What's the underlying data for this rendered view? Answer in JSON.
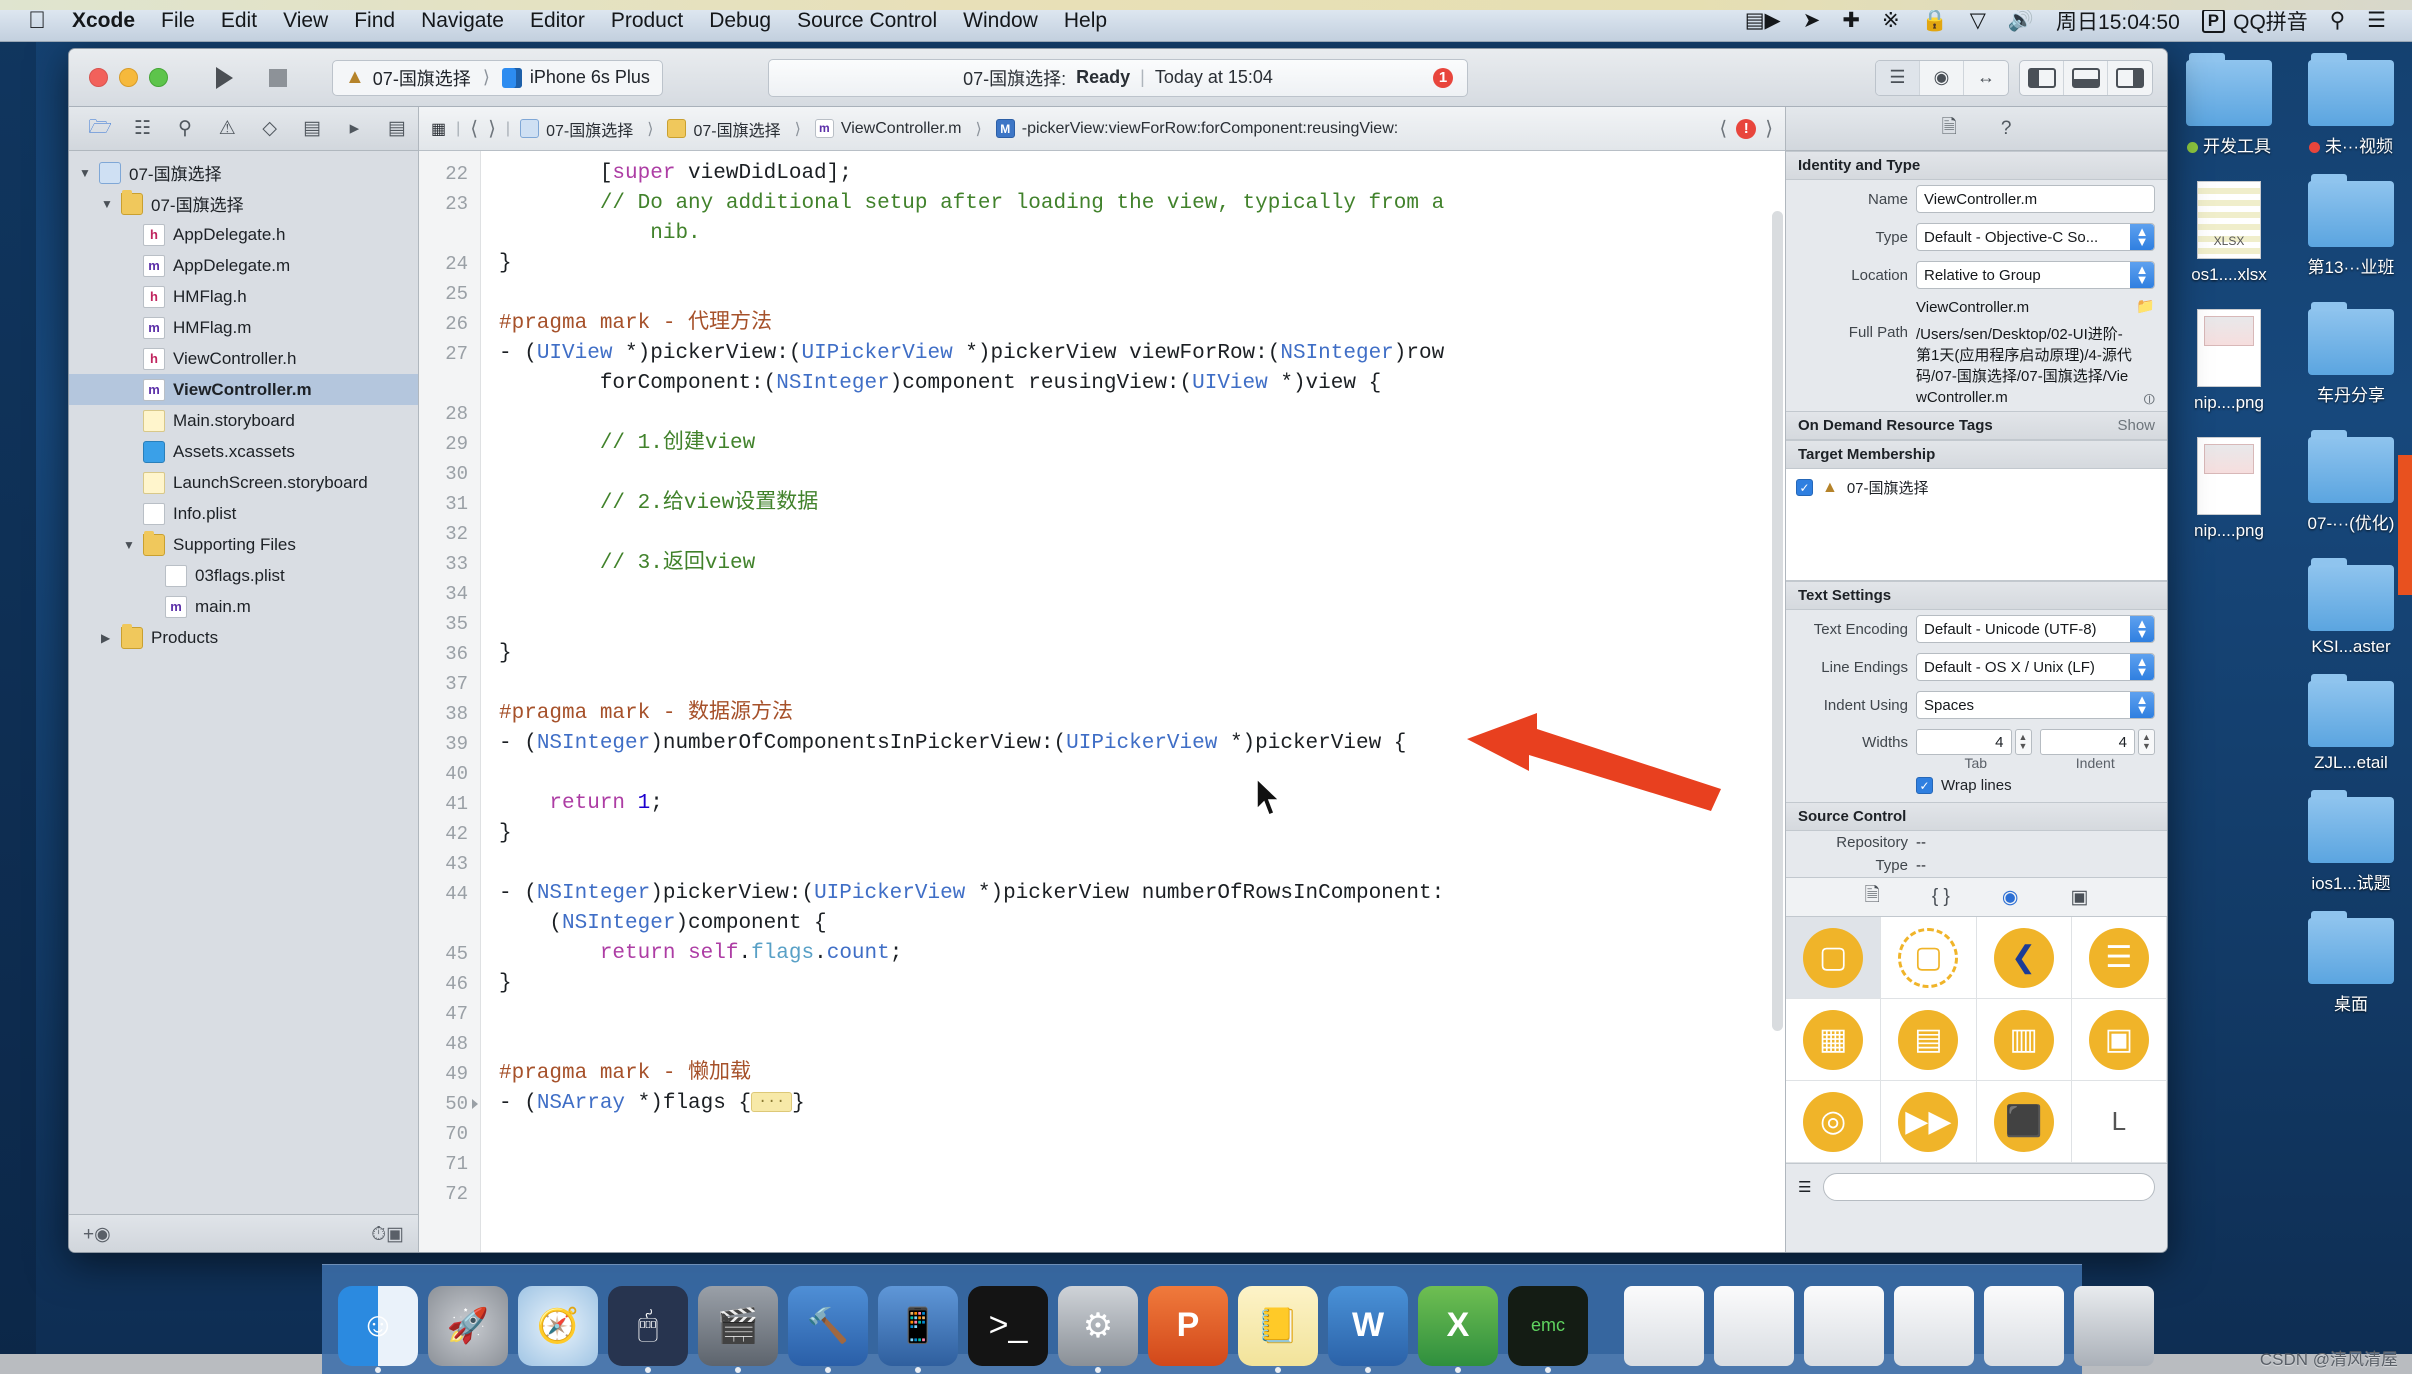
{
  "menubar": {
    "apple_icon": "apple-logo-icon",
    "items": [
      {
        "label": "Xcode",
        "bold": true
      },
      {
        "label": "File",
        "bold": false
      },
      {
        "label": "Edit",
        "bold": false
      },
      {
        "label": "View",
        "bold": false
      },
      {
        "label": "Find",
        "bold": false
      },
      {
        "label": "Navigate",
        "bold": false
      },
      {
        "label": "Editor",
        "bold": false
      },
      {
        "label": "Product",
        "bold": false
      },
      {
        "label": "Debug",
        "bold": false
      },
      {
        "label": "Source Control",
        "bold": false
      },
      {
        "label": "Window",
        "bold": false
      },
      {
        "label": "Help",
        "bold": false
      }
    ],
    "status_icons": [
      "screen-recorder-icon",
      "location-arrow-icon",
      "airdrop-icon",
      "bluetooth-icon",
      "lock-icon",
      "wifi-icon",
      "volume-icon"
    ],
    "clock": "周日15:04:50",
    "input_method_badge": "P",
    "input_method": "QQ拼音",
    "search_icon": "spotlight-search-icon",
    "notification_icon": "notification-center-icon"
  },
  "xcode": {
    "toolbar": {
      "run_icon": "run-play-icon",
      "stop_icon": "stop-square-icon",
      "scheme_name": "07-国旗选择",
      "destination": "iPhone 6s Plus",
      "status_project": "07-国旗选择:",
      "status_state": "Ready",
      "status_separator": "|",
      "status_time": "Today at 15:04",
      "issue_count": "1",
      "editor_segments": [
        "standard-editor-icon",
        "assistant-editor-icon",
        "version-editor-icon"
      ],
      "panel_toggles": [
        "toggle-navigator-icon",
        "toggle-debug-area-icon",
        "toggle-utilities-icon"
      ]
    },
    "navigator": {
      "tabs": [
        "project-navigator-icon",
        "symbol-navigator-icon",
        "find-navigator-icon",
        "issue-navigator-icon",
        "test-navigator-icon",
        "debug-navigator-icon",
        "breakpoint-navigator-icon",
        "report-navigator-icon"
      ],
      "tree": [
        {
          "label": "07-国旗选择",
          "depth": 0,
          "icon": "project-icon",
          "disclosure": "open",
          "selected": false
        },
        {
          "label": "07-国旗选择",
          "depth": 1,
          "icon": "folder-icon",
          "disclosure": "open",
          "selected": false
        },
        {
          "label": "AppDelegate.h",
          "depth": 2,
          "icon": "header-file-icon",
          "disclosure": "none",
          "selected": false
        },
        {
          "label": "AppDelegate.m",
          "depth": 2,
          "icon": "objc-file-icon",
          "disclosure": "none",
          "selected": false
        },
        {
          "label": "HMFlag.h",
          "depth": 2,
          "icon": "header-file-icon",
          "disclosure": "none",
          "selected": false
        },
        {
          "label": "HMFlag.m",
          "depth": 2,
          "icon": "objc-file-icon",
          "disclosure": "none",
          "selected": false
        },
        {
          "label": "ViewController.h",
          "depth": 2,
          "icon": "header-file-icon",
          "disclosure": "none",
          "selected": false
        },
        {
          "label": "ViewController.m",
          "depth": 2,
          "icon": "objc-file-icon",
          "disclosure": "none",
          "selected": true
        },
        {
          "label": "Main.storyboard",
          "depth": 2,
          "icon": "storyboard-icon",
          "disclosure": "none",
          "selected": false
        },
        {
          "label": "Assets.xcassets",
          "depth": 2,
          "icon": "assets-icon",
          "disclosure": "none",
          "selected": false
        },
        {
          "label": "LaunchScreen.storyboard",
          "depth": 2,
          "icon": "storyboard-icon",
          "disclosure": "none",
          "selected": false
        },
        {
          "label": "Info.plist",
          "depth": 2,
          "icon": "plist-icon",
          "disclosure": "none",
          "selected": false
        },
        {
          "label": "Supporting Files",
          "depth": 2,
          "icon": "folder-icon",
          "disclosure": "open",
          "selected": false
        },
        {
          "label": "03flags.plist",
          "depth": 3,
          "icon": "plist-icon",
          "disclosure": "none",
          "selected": false
        },
        {
          "label": "main.m",
          "depth": 3,
          "icon": "objc-file-icon",
          "disclosure": "none",
          "selected": false
        },
        {
          "label": "Products",
          "depth": 1,
          "icon": "folder-icon",
          "disclosure": "closed",
          "selected": false
        }
      ],
      "footer": {
        "add_icon": "add-plus-icon",
        "filter_icon": "filter-icon",
        "recent_icon": "recent-files-icon",
        "source_icon": "source-control-filter-icon"
      }
    },
    "jumpbar": {
      "related_icon": "related-items-icon",
      "back_icon": "back-chevron-icon",
      "forward_icon": "forward-chevron-icon",
      "crumbs": [
        {
          "label": "07-国旗选择",
          "icon": "project-icon"
        },
        {
          "label": "07-国旗选择",
          "icon": "folder-icon"
        },
        {
          "label": "ViewController.m",
          "icon": "objc-file-icon"
        },
        {
          "label": "-pickerView:viewForRow:forComponent:reusingView:",
          "icon": "method-icon"
        }
      ],
      "prev_issue_icon": "previous-issue-icon",
      "issue_icon": "issue-error-icon"
    },
    "code": {
      "lines": [
        {
          "n": "22",
          "html": "        [<span class=\"k\">super</span> viewDidLoad];"
        },
        {
          "n": "23",
          "html": "        <span class=\"cm\">// Do any additional setup after loading the view, typically from a</span>"
        },
        {
          "n": "",
          "html": "            <span class=\"cm\">nib.</span>"
        },
        {
          "n": "24",
          "html": "}"
        },
        {
          "n": "25",
          "html": ""
        },
        {
          "n": "26",
          "html": "<span class=\"pp\">#pragma mark</span> <span class=\"pp\">- 代理方法</span>"
        },
        {
          "n": "27",
          "html": "- (<span class=\"t\">UIView</span> *)pickerView:(<span class=\"t\">UIPickerView</span> *)pickerView viewForRow:(<span class=\"t\">NSInteger</span>)row"
        },
        {
          "n": "",
          "html": "        forComponent:(<span class=\"t\">NSInteger</span>)component reusingView:(<span class=\"t\">UIView</span> *)view {"
        },
        {
          "n": "28",
          "html": ""
        },
        {
          "n": "29",
          "html": "        <span class=\"cm\">// 1.创建view</span>"
        },
        {
          "n": "30",
          "html": ""
        },
        {
          "n": "31",
          "html": "        <span class=\"cm\">// 2.给view设置数据</span>"
        },
        {
          "n": "32",
          "html": ""
        },
        {
          "n": "33",
          "html": "        <span class=\"cm\">// 3.返回view</span>"
        },
        {
          "n": "34",
          "html": ""
        },
        {
          "n": "35",
          "html": ""
        },
        {
          "n": "36",
          "html": "}",
          "error": true
        },
        {
          "n": "37",
          "html": ""
        },
        {
          "n": "38",
          "html": "<span class=\"pp\">#pragma mark</span> <span class=\"pp\">- 数据源方法</span>"
        },
        {
          "n": "39",
          "html": "- (<span class=\"t\">NSInteger</span>)numberOfComponentsInPickerView:(<span class=\"t\">UIPickerView</span> *)pickerView {"
        },
        {
          "n": "40",
          "html": ""
        },
        {
          "n": "41",
          "html": "    <span class=\"k\">return</span> <span class=\"num\">1</span>;"
        },
        {
          "n": "42",
          "html": "}"
        },
        {
          "n": "43",
          "html": ""
        },
        {
          "n": "44",
          "html": "- (<span class=\"t\">NSInteger</span>)pickerView:(<span class=\"t\">UIPickerView</span> *)pickerView numberOfRowsInComponent:"
        },
        {
          "n": "",
          "html": "    (<span class=\"t\">NSInteger</span>)component {"
        },
        {
          "n": "45",
          "html": "        <span class=\"k\">return</span> <span class=\"k\">self</span>.<span class=\"prop\">flags</span>.<span class=\"t\">count</span>;"
        },
        {
          "n": "46",
          "html": "}"
        },
        {
          "n": "47",
          "html": ""
        },
        {
          "n": "48",
          "html": ""
        },
        {
          "n": "49",
          "html": "<span class=\"pp\">#pragma mark</span> <span class=\"pp\">- 懒加载</span>"
        },
        {
          "n": "50",
          "html": "- (<span class=\"t\">NSArray</span> *)flags {<span class=\"foldbox\">···</span>}",
          "fold": true
        },
        {
          "n": "70",
          "html": ""
        },
        {
          "n": "71",
          "html": ""
        },
        {
          "n": "72",
          "html": ""
        }
      ]
    },
    "inspector": {
      "tabs": [
        "file-inspector-icon",
        "quick-help-icon"
      ],
      "identity": {
        "title": "Identity and Type",
        "name_label": "Name",
        "name_value": "ViewController.m",
        "type_label": "Type",
        "type_value": "Default - Objective-C So...",
        "location_label": "Location",
        "location_value": "Relative to Group",
        "location_file": "ViewController.m",
        "folder_icon": "choose-folder-icon",
        "fullpath_label": "Full Path",
        "fullpath_value": "/Users/sen/Desktop/02-UI进阶-第1天(应用程序启动原理)/4-源代码/07-国旗选择/07-国旗选择/ViewController.m",
        "reveal_icon": "reveal-in-finder-icon"
      },
      "ondemand": {
        "title": "On Demand Resource Tags",
        "show": "Show"
      },
      "target_membership": {
        "title": "Target Membership",
        "items": [
          {
            "label": "07-国旗选择",
            "checked": true,
            "icon": "xcode-target-icon"
          }
        ]
      },
      "text_settings": {
        "title": "Text Settings",
        "encoding_label": "Text Encoding",
        "encoding_value": "Default - Unicode (UTF-8)",
        "line_endings_label": "Line Endings",
        "line_endings_value": "Default - OS X / Unix (LF)",
        "indent_label": "Indent Using",
        "indent_value": "Spaces",
        "widths_label": "Widths",
        "tab_width": "4",
        "indent_width": "4",
        "tab_sublabel": "Tab",
        "indent_sublabel": "Indent",
        "wrap_label": "Wrap lines",
        "wrap_checked": true
      },
      "source_control": {
        "title": "Source Control",
        "repository_label": "Repository",
        "repository_value": "--",
        "type_label": "Type",
        "type_value": "--"
      },
      "library": {
        "tabs": [
          "file-template-library-icon",
          "code-snippet-library-icon",
          "object-library-icon",
          "media-library-icon"
        ],
        "selected_tab_index": 2,
        "items": [
          {
            "icon": "view-object-icon",
            "selected": true
          },
          {
            "icon": "view-controller-placeholder-icon",
            "selected": false
          },
          {
            "icon": "back-navigation-object-icon",
            "selected": false
          },
          {
            "icon": "table-view-object-icon",
            "selected": false
          },
          {
            "icon": "collection-view-object-icon",
            "selected": false
          },
          {
            "icon": "table-cell-object-icon",
            "selected": false
          },
          {
            "icon": "split-view-object-icon",
            "selected": false
          },
          {
            "icon": "container-view-object-icon",
            "selected": false
          },
          {
            "icon": "image-view-object-icon",
            "selected": false
          },
          {
            "icon": "player-view-object-icon",
            "selected": false
          },
          {
            "icon": "scene-kit-object-icon",
            "selected": false
          },
          {
            "icon": "label-object-icon",
            "selected": false
          }
        ],
        "footer_list_icon": "list-view-icon",
        "footer_search_icon": "library-search-icon"
      }
    }
  },
  "desktop": {
    "icons": [
      {
        "label": "开发工具",
        "type": "folder",
        "dot": "#8cc63f"
      },
      {
        "label": "未···视频",
        "type": "folder",
        "dot": "#e8453c"
      },
      {
        "label": "os1....xlsx",
        "type": "file-xlsx"
      },
      {
        "label": "第13···业班",
        "type": "folder"
      },
      {
        "label": "nip....png",
        "type": "file-png"
      },
      {
        "label": "车丹分享",
        "type": "folder"
      },
      {
        "label": "nip....png",
        "type": "file-png"
      },
      {
        "label": "07-···(优化)",
        "type": "folder"
      },
      {
        "label": "",
        "type": "blank"
      },
      {
        "label": "KSI...aster",
        "type": "folder"
      },
      {
        "label": "",
        "type": "blank"
      },
      {
        "label": "ZJL...etail",
        "type": "folder"
      },
      {
        "label": "",
        "type": "blank"
      },
      {
        "label": "ios1...试题",
        "type": "folder"
      },
      {
        "label": "",
        "type": "blank"
      },
      {
        "label": "桌面",
        "type": "folder"
      }
    ]
  },
  "dock": {
    "items": [
      {
        "name": "finder-icon",
        "glyph": "☺",
        "running": true
      },
      {
        "name": "launchpad-icon",
        "glyph": "🚀",
        "running": false
      },
      {
        "name": "safari-icon",
        "glyph": "🧭",
        "running": false
      },
      {
        "name": "mouse-app-icon",
        "glyph": "🖱",
        "running": true
      },
      {
        "name": "imovie-icon",
        "glyph": "🎬",
        "running": true
      },
      {
        "name": "xcode-icon",
        "glyph": "🔨",
        "running": true
      },
      {
        "name": "simulator-icon",
        "glyph": "📱",
        "running": true
      },
      {
        "name": "terminal-icon",
        "glyph": ">_",
        "running": false
      },
      {
        "name": "system-preferences-icon",
        "glyph": "⚙",
        "running": true
      },
      {
        "name": "pages-icon",
        "glyph": "P",
        "running": false
      },
      {
        "name": "notes-icon",
        "glyph": "📒",
        "running": true
      },
      {
        "name": "word-icon",
        "glyph": "W",
        "running": true
      },
      {
        "name": "excel-icon",
        "glyph": "X",
        "running": true
      },
      {
        "name": "emacs-icon",
        "glyph": "emc",
        "running": true
      }
    ],
    "stack_items": [
      {
        "name": "downloads-stack-icon"
      },
      {
        "name": "documents-stack-icon"
      },
      {
        "name": "notes-stack-icon"
      },
      {
        "name": "screenshots-stack-icon"
      },
      {
        "name": "desktop-stack-icon"
      },
      {
        "name": "trash-icon"
      }
    ]
  },
  "annotation": {
    "arrow_color": "#e8401f",
    "arrow_name": "red-pointer-arrow"
  },
  "watermark": "CSDN @清风清屋"
}
